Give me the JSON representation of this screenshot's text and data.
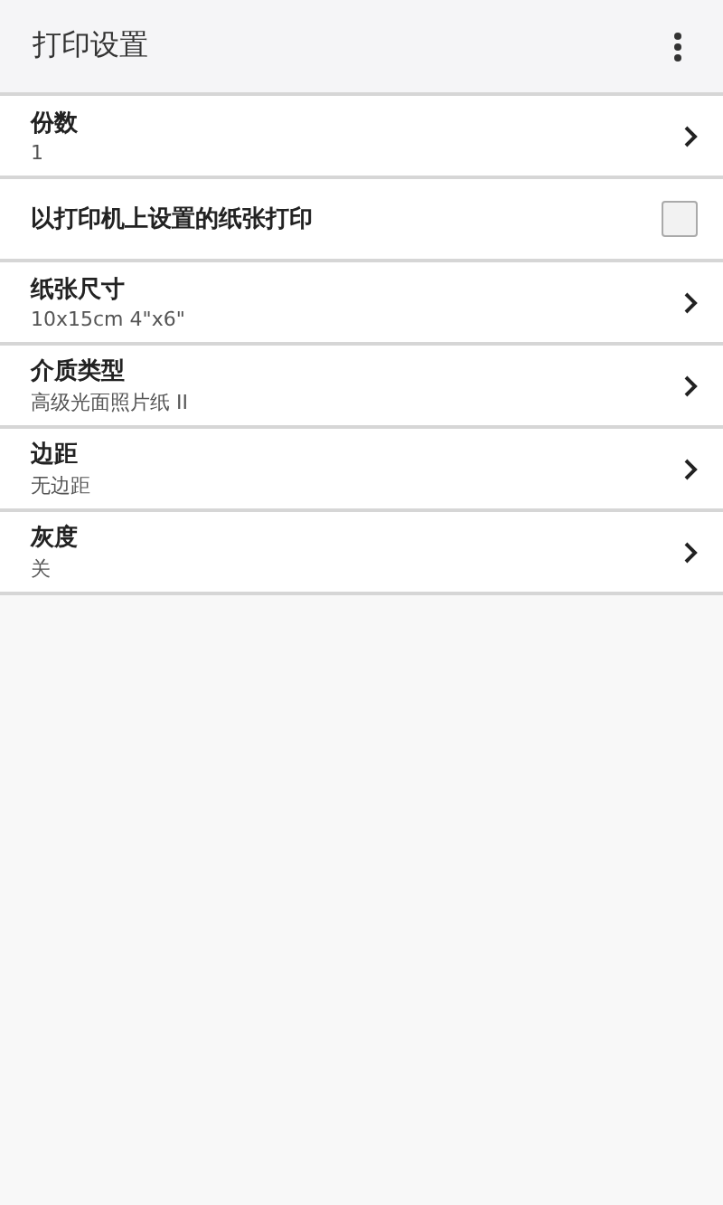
{
  "app_bar": {
    "title": "打印设置"
  },
  "settings": [
    {
      "kind": "nav",
      "label": "份数",
      "value": "1"
    },
    {
      "kind": "checkbox",
      "label": "以打印机上设置的纸张打印",
      "checked": false
    },
    {
      "kind": "nav",
      "label": "纸张尺寸",
      "value": "10x15cm 4\"x6\""
    },
    {
      "kind": "nav",
      "label": "介质类型",
      "value": "高级光面照片纸 II"
    },
    {
      "kind": "nav",
      "label": "边距",
      "value": "无边距"
    },
    {
      "kind": "nav",
      "label": "灰度",
      "value": "关"
    }
  ]
}
